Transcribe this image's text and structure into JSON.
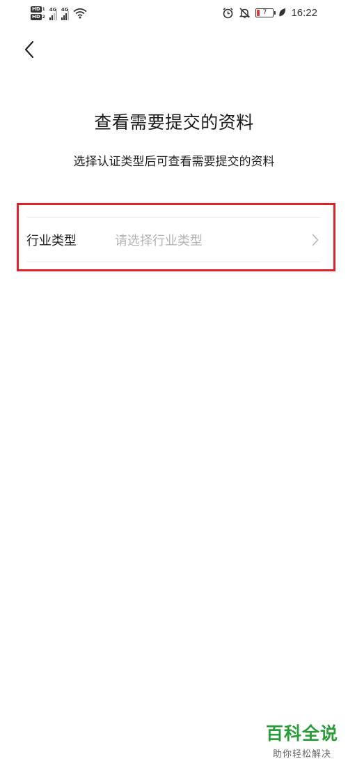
{
  "status_bar": {
    "hd_label": "HD",
    "sim1_index": "1",
    "sim2_index": "2",
    "network1": "4G",
    "network2": "4G",
    "battery_level": "7",
    "time": "16:22",
    "icons": [
      "alarm-icon",
      "mute-icon",
      "battery-icon",
      "leaf-icon",
      "wifi-icon",
      "signal-icon"
    ]
  },
  "header": {
    "back_icon": "chevron-left-icon",
    "title": "查看需要提交的资料",
    "subtitle": "选择认证类型后可查看需要提交的资料"
  },
  "form": {
    "industry_label": "行业类型",
    "industry_placeholder": "请选择行业类型",
    "chevron_icon": "chevron-right-icon"
  },
  "highlight_color": "#e0202b",
  "watermark": {
    "main": "百科全说",
    "sub": "助你轻松解决",
    "color": "#2a9d3a"
  }
}
